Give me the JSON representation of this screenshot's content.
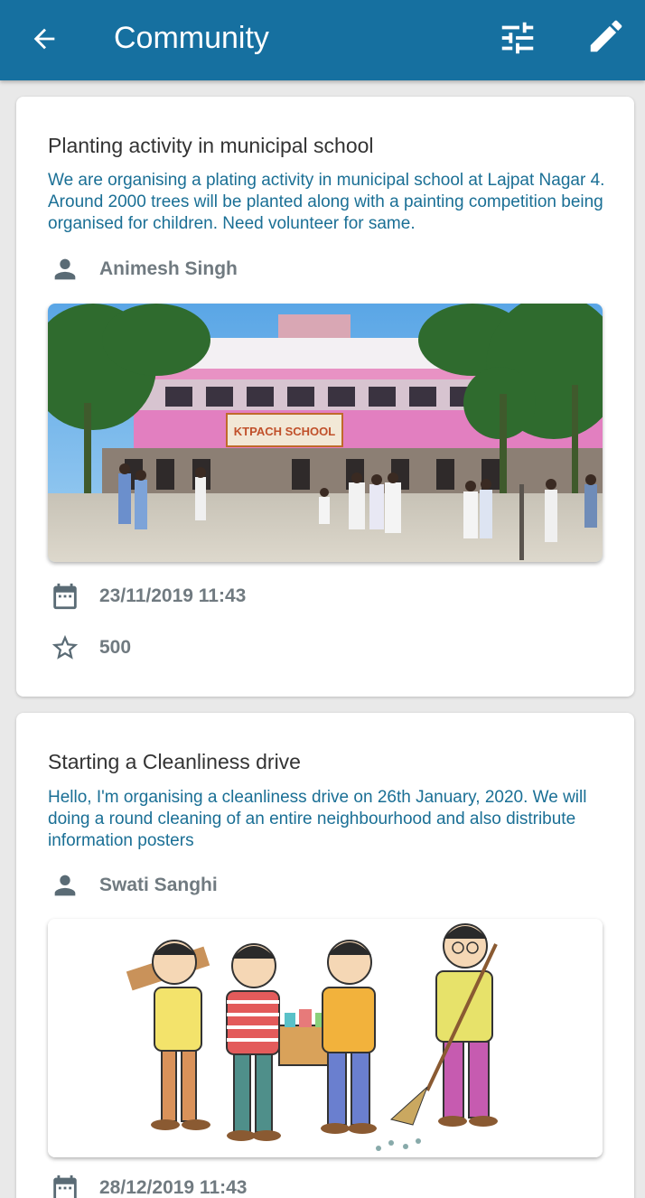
{
  "appbar": {
    "title": "Community",
    "back_icon": "arrow-back-icon",
    "filter_icon": "tune-icon",
    "edit_icon": "pencil-icon",
    "color": "#1670a0"
  },
  "posts": [
    {
      "title": "Planting activity in municipal school",
      "description": "We are organising a plating activity in municipal school at Lajpat Nagar 4. Around 2000 trees will be planted along with a painting competition being organised for children. Need volunteer for same.",
      "author": "Animesh Singh",
      "image_sign": "KTPACH SCHOOL",
      "date": "23/11/2019 11:43",
      "stars": "500"
    },
    {
      "title": "Starting a Cleanliness drive",
      "description": "Hello, I'm organising a cleanliness drive on 26th January, 2020. We will doing a round cleaning of an entire neighbourhood and also distribute information posters",
      "author": "Swati Sanghi",
      "date": "28/12/2019 11:43"
    }
  ],
  "colors": {
    "description_text": "#1a6f95",
    "meta_text": "#707a80",
    "icon": "#5a6b75"
  }
}
